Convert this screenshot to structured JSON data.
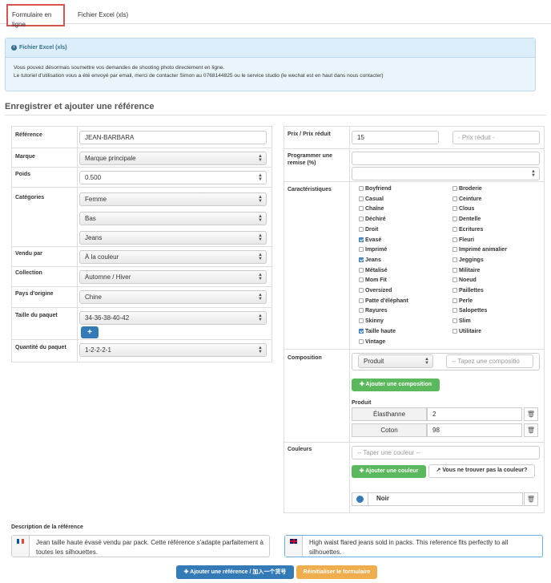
{
  "tabs": {
    "online": "Formulaire en ligne",
    "excel": "Fichier Excel (xls)"
  },
  "alert": {
    "title": "Fichier Excel (xls)",
    "line1": "Vous pouvez désormais soumettre vos demandes de shooting photo directement en ligne.",
    "line2": "Le tutoriel d'utilisation vous a été envoyé par email, merci de contacter Simon au 0768144825 ou le service studio (le wechat est en haut dans nous contacter)"
  },
  "section_title": "Enregistrer et ajouter une référence",
  "left": {
    "reference": {
      "label": "Référence",
      "value": "JEAN-BARBARA"
    },
    "marque": {
      "label": "Marque",
      "value": "Marque principale"
    },
    "poids": {
      "label": "Poids",
      "value": "0.500"
    },
    "categories": {
      "label": "Catégories",
      "values": [
        "Femme",
        "Bas",
        "Jeans"
      ]
    },
    "vendu_par": {
      "label": "Vendu par",
      "value": "À la couleur"
    },
    "collection": {
      "label": "Collection",
      "value": "Automne / Hiver"
    },
    "pays": {
      "label": "Pays d'origine",
      "value": "Chine"
    },
    "taille": {
      "label": "Taille du paquet",
      "value": "34-36-38-40-42",
      "add": "+"
    },
    "quantite": {
      "label": "Quantité du paquet",
      "value": "1-2-2-2-1"
    }
  },
  "right": {
    "prix": {
      "label": "Prix / Prix réduit",
      "value": "15",
      "reduced_placeholder": "- Prix réduit -"
    },
    "remise": {
      "label": "Programmer une remise (%)"
    },
    "caracteristiques": {
      "label": "Caractéristiques",
      "col1": [
        {
          "name": "Boyfriend",
          "checked": false
        },
        {
          "name": "Casual",
          "checked": false
        },
        {
          "name": "Chaîne",
          "checked": false
        },
        {
          "name": "Déchiré",
          "checked": false
        },
        {
          "name": "Droit",
          "checked": false
        },
        {
          "name": "Evasé",
          "checked": true
        },
        {
          "name": "Imprimé",
          "checked": false
        },
        {
          "name": "Jeans",
          "checked": true
        },
        {
          "name": "Métalisé",
          "checked": false
        },
        {
          "name": "Mom Fit",
          "checked": false
        },
        {
          "name": "Oversized",
          "checked": false
        },
        {
          "name": "Patte d'éléphant",
          "checked": false
        },
        {
          "name": "Rayures",
          "checked": false
        },
        {
          "name": "Skinny",
          "checked": false
        },
        {
          "name": "Taille haute",
          "checked": true
        },
        {
          "name": "Vintage",
          "checked": false
        }
      ],
      "col2": [
        {
          "name": "Broderie",
          "checked": false
        },
        {
          "name": "Ceinture",
          "checked": false
        },
        {
          "name": "Clous",
          "checked": false
        },
        {
          "name": "Dentelle",
          "checked": false
        },
        {
          "name": "Ecritures",
          "checked": false
        },
        {
          "name": "Fleuri",
          "checked": false
        },
        {
          "name": "Imprimé animalier",
          "checked": false
        },
        {
          "name": "Jeggings",
          "checked": false
        },
        {
          "name": "Militaire",
          "checked": false
        },
        {
          "name": "Noeud",
          "checked": false
        },
        {
          "name": "Paillettes",
          "checked": false
        },
        {
          "name": "Perle",
          "checked": false
        },
        {
          "name": "Salopettes",
          "checked": false
        },
        {
          "name": "Slim",
          "checked": false
        },
        {
          "name": "Utilitaire",
          "checked": false
        }
      ]
    },
    "composition": {
      "label": "Composition",
      "select": "Produit",
      "placeholder": "-- Tapez une compositio",
      "add_button": "Ajouter une composition",
      "sub_label": "Produit",
      "items": [
        {
          "name": "Élasthanne",
          "value": "2"
        },
        {
          "name": "Coton",
          "value": "98"
        }
      ]
    },
    "couleurs": {
      "label": "Couleurs",
      "placeholder": "-- Taper une couleur --",
      "add_button": "Ajouter une couleur",
      "missing_button": "Vous ne trouver pas la couleur?",
      "item": "Noir"
    }
  },
  "description": {
    "label": "Description de la référence",
    "fr": "Jean taille haute évasé vendu par pack. Cette référence s'adapte parfaitement à toutes les silhouettes.",
    "en": "High waist flared jeans sold in packs. This reference fits perfectly to all silhouettes."
  },
  "buttons": {
    "add": "Ajouter une référence / 加入一个货号",
    "reset": "Réinitialiser le formulaire"
  },
  "colors": {
    "primary": "#337ab7",
    "success": "#5cb85c",
    "warning": "#f0ad4e",
    "highlight": "#d9534f"
  }
}
